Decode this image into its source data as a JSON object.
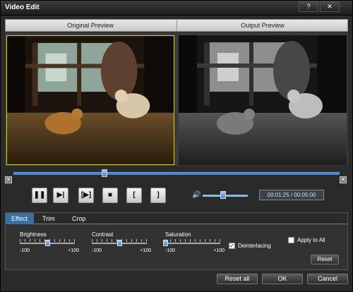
{
  "window": {
    "title": "Video Edit",
    "help_glyph": "?",
    "close_glyph": "✕"
  },
  "preview": {
    "original_label": "Original Preview",
    "output_label": "Output Preview"
  },
  "timeline": {
    "progress": 0.28,
    "start_marker": "✕",
    "end_marker": "✕"
  },
  "controls": {
    "pause": "❚❚",
    "next_frame": "▶|",
    "snapshot": "[▶]",
    "stop": "■",
    "mark_in": "[",
    "mark_out": "]",
    "volume_glyph": "🔊",
    "volume_level": 0.45,
    "time_display": "00:01:25 / 00:05:00"
  },
  "tabs": [
    {
      "label": "Effect",
      "active": true
    },
    {
      "label": "Trim",
      "active": false
    },
    {
      "label": "Crop",
      "active": false
    }
  ],
  "effect": {
    "brightness": {
      "label": "Brightness",
      "min": "-100",
      "max": "+100",
      "value": 0
    },
    "contrast": {
      "label": "Contrast",
      "min": "-100",
      "max": "+100",
      "value": 0
    },
    "saturation": {
      "label": "Saturation",
      "min": "-100",
      "max": "+100",
      "value": -100
    },
    "deinterlacing": {
      "label": "Deinterlacing",
      "checked": true,
      "mark": "✓"
    },
    "apply_to_all": {
      "label": "Apply to All",
      "checked": false
    },
    "reset_label": "Reset"
  },
  "footer": {
    "reset_all_label": "Reset all",
    "ok_label": "OK",
    "cancel_label": "Cancel"
  },
  "colors": {
    "accent": "#4a86c5",
    "active_tab": "#3a6fa3",
    "selection_border": "#d6d600"
  }
}
